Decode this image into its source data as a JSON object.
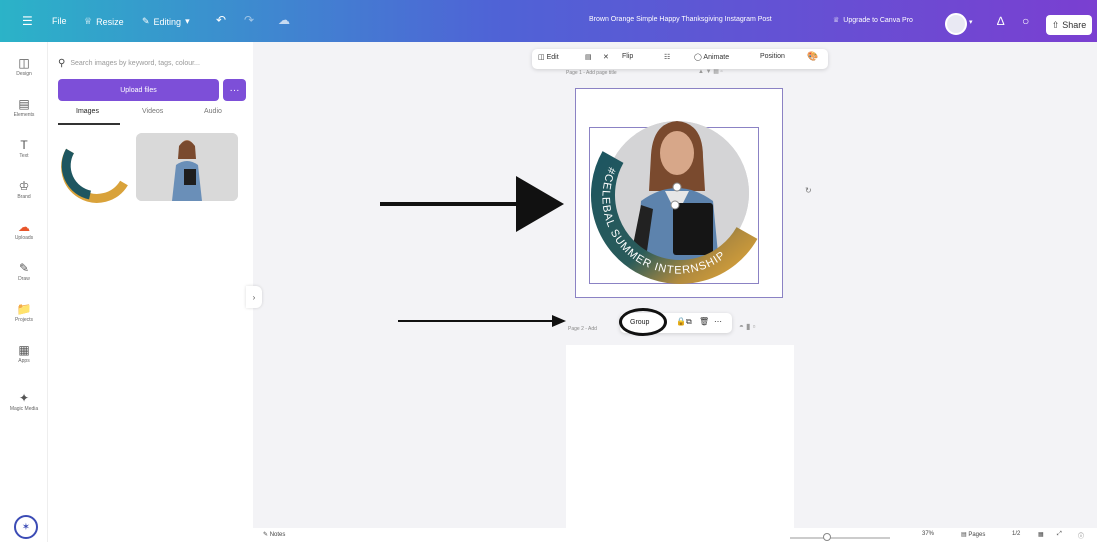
{
  "topbar": {
    "menu_icon": "hamburger-icon",
    "file": "File",
    "resize": "Resize",
    "editing": "Editing",
    "doc_title": "Brown Orange Simple Happy Thanksgiving Instagram Post",
    "upgrade": "Upgrade to Canva Pro",
    "share": "Share"
  },
  "rail": {
    "items": [
      {
        "label": "Design",
        "icon": "design-icon"
      },
      {
        "label": "Elements",
        "icon": "elements-icon"
      },
      {
        "label": "Text",
        "icon": "text-icon"
      },
      {
        "label": "Brand",
        "icon": "brand-icon"
      },
      {
        "label": "Uploads",
        "icon": "uploads-icon"
      },
      {
        "label": "Draw",
        "icon": "draw-icon"
      },
      {
        "label": "Projects",
        "icon": "projects-icon"
      },
      {
        "label": "Apps",
        "icon": "apps-icon"
      },
      {
        "label": "Magic Media",
        "icon": "magic-media-icon"
      }
    ]
  },
  "panel": {
    "search_placeholder": "Search images by keyword, tags, colour...",
    "upload_label": "Upload files",
    "more_label": "···",
    "tabs": [
      "Images",
      "Videos",
      "Audio"
    ]
  },
  "context_bar": {
    "edit": "Edit",
    "flip": "Flip",
    "animate": "Animate",
    "position": "Position"
  },
  "canvas": {
    "page1_label": "Page 1 - Add page title",
    "page2_label": "Page 2 - Add",
    "group_label": "Group",
    "badge_text": "#CELEBAL SUMMER INTERNSHIP"
  },
  "bottom": {
    "notes": "Notes",
    "zoom": "37%",
    "pages": "Pages",
    "page_count": "1/2"
  },
  "colors": {
    "accent": "#7d4fd8",
    "selection": "#8b82c4",
    "gradient_start": "#2bb3c8",
    "gradient_end": "#7a3fd1",
    "badge_teal": "#1e5660",
    "badge_gold": "#d9a23a"
  }
}
